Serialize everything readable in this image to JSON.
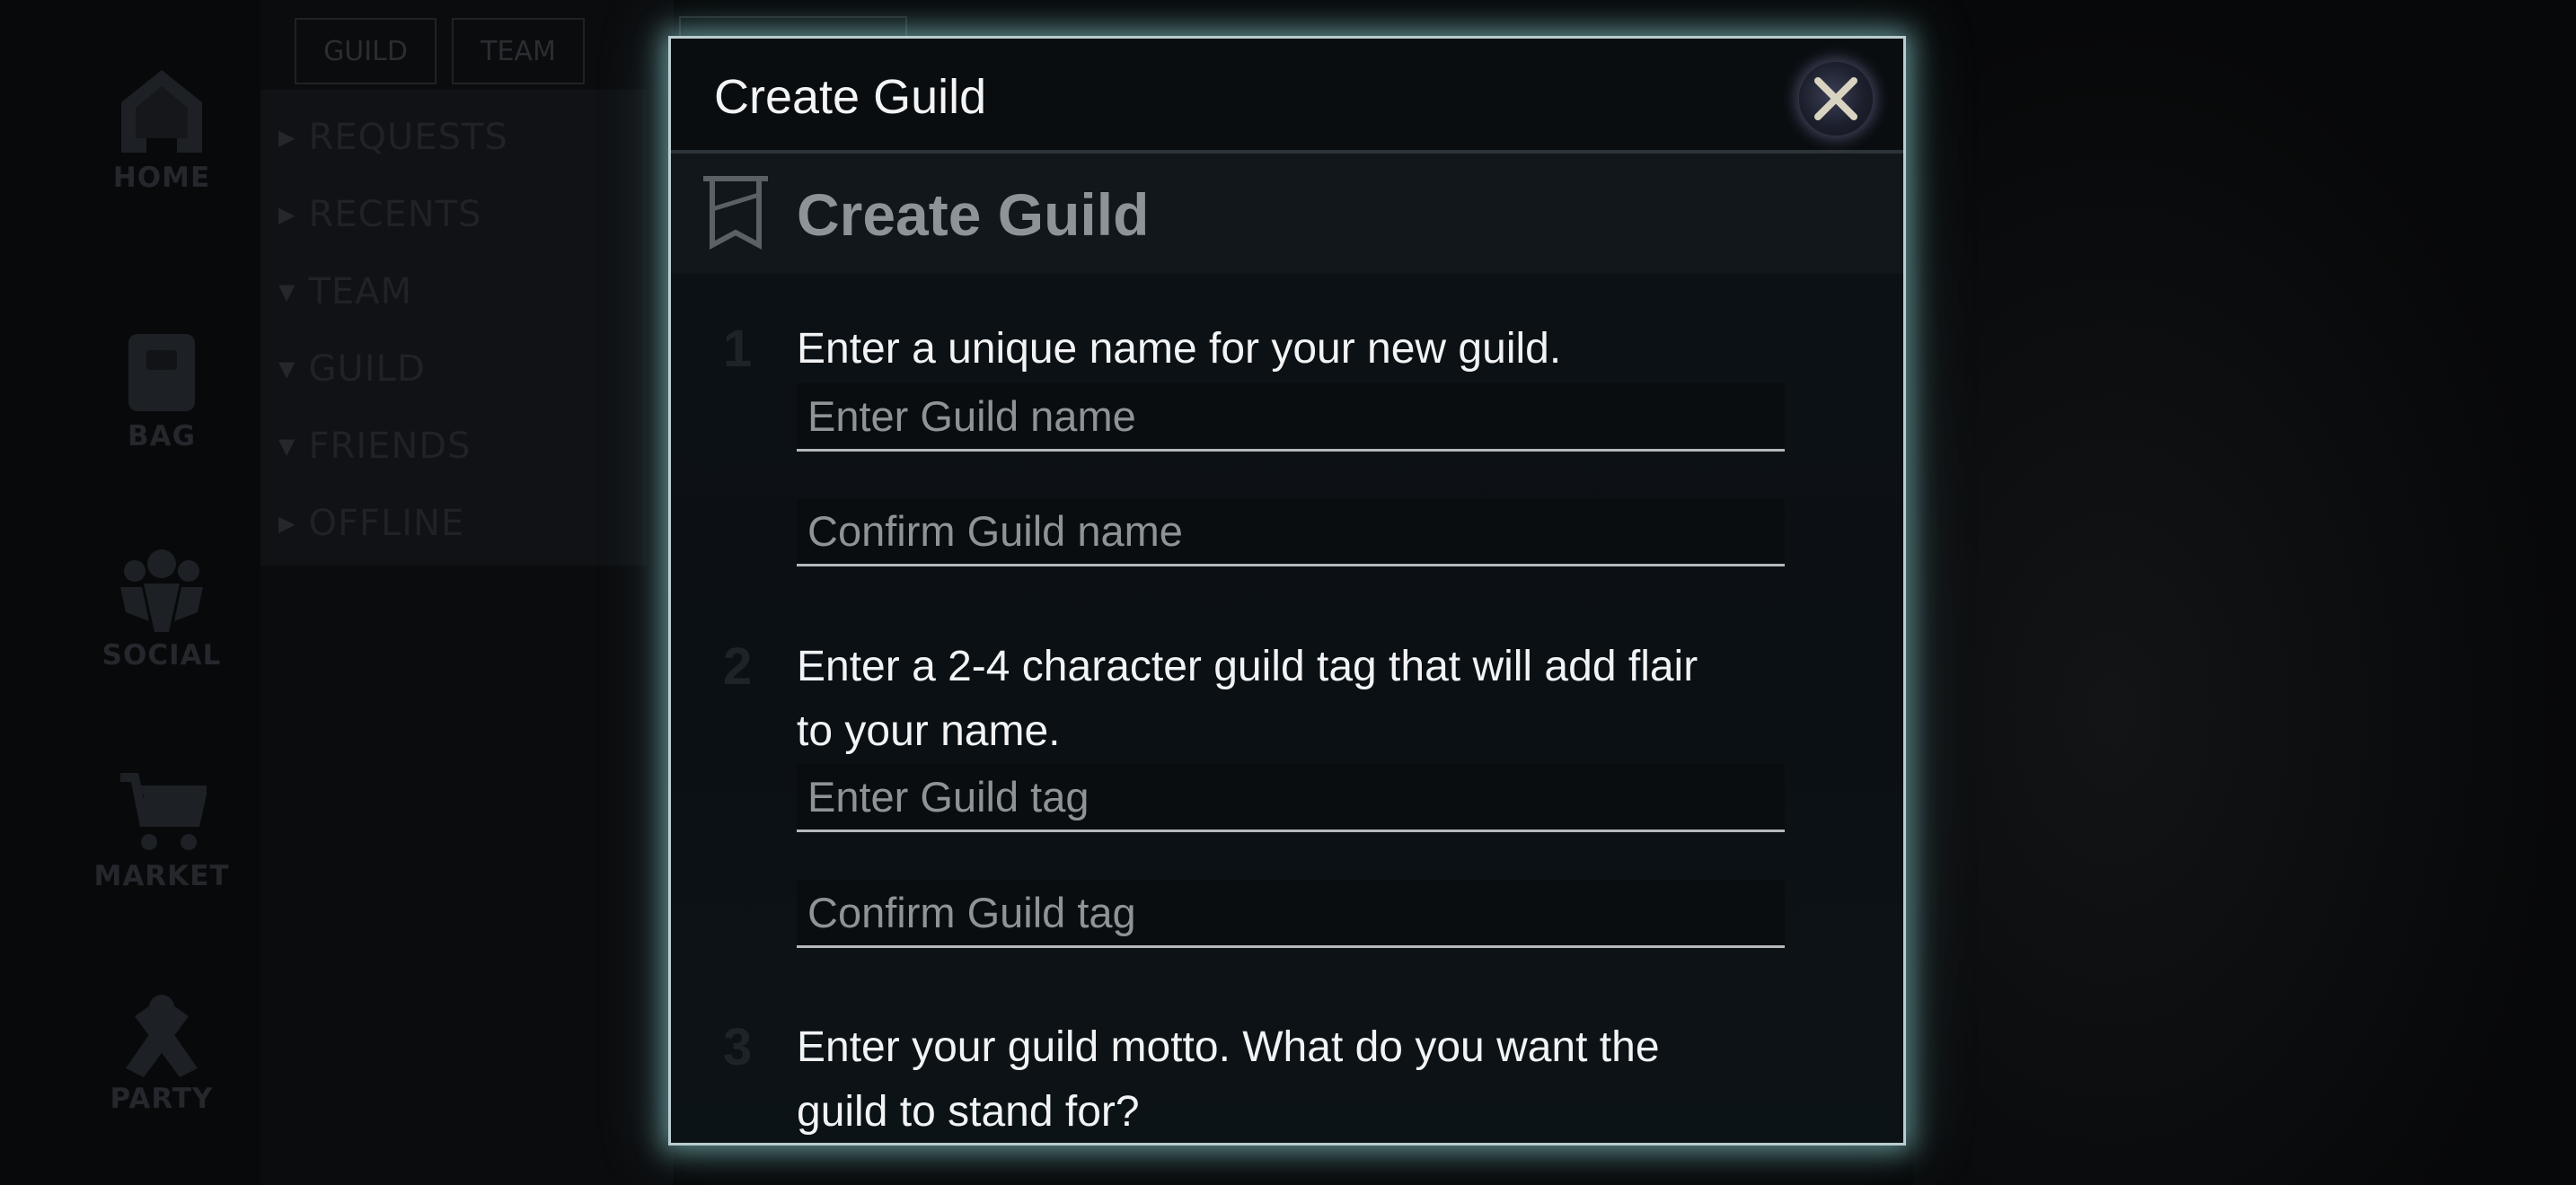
{
  "background": {
    "nav": [
      {
        "label": "HOME",
        "icon": "home-icon"
      },
      {
        "label": "BAG",
        "icon": "bag-icon"
      },
      {
        "label": "SOCIAL",
        "icon": "social-icon"
      },
      {
        "label": "MARKET",
        "icon": "cart-icon"
      },
      {
        "label": "PARTY",
        "icon": "party-icon"
      }
    ],
    "tabs": [
      "GUILD",
      "TEAM"
    ],
    "sections": [
      {
        "label": "REQUESTS",
        "expanded": false
      },
      {
        "label": "RECENTS",
        "expanded": false
      },
      {
        "label": "TEAM",
        "expanded": true
      },
      {
        "label": "GUILD",
        "expanded": true
      },
      {
        "label": "FRIENDS",
        "expanded": true
      },
      {
        "label": "OFFLINE",
        "expanded": false
      }
    ]
  },
  "modal": {
    "title": "Create Guild",
    "close_icon": "close-icon",
    "section_icon": "banner-icon",
    "section_title": "Create Guild",
    "steps": [
      {
        "number": "1",
        "text": "Enter a unique name for your new guild.",
        "fields": [
          {
            "placeholder": "Enter Guild name",
            "value": ""
          },
          {
            "placeholder": "Confirm Guild name",
            "value": ""
          }
        ]
      },
      {
        "number": "2",
        "text_line1": "Enter a 2-4 character guild tag that will add flair",
        "text_line2": "to your name.",
        "fields": [
          {
            "placeholder": "Enter Guild tag",
            "value": ""
          },
          {
            "placeholder": "Confirm Guild tag",
            "value": ""
          }
        ]
      },
      {
        "number": "3",
        "text_line1": "Enter your guild motto. What do you want the",
        "text_line2": "guild to stand for?"
      }
    ]
  },
  "colors": {
    "modal_glow": "#9fd8d8",
    "text_primary": "#f1f3f4",
    "placeholder": "#8d9397",
    "section_title": "#8c9499"
  }
}
